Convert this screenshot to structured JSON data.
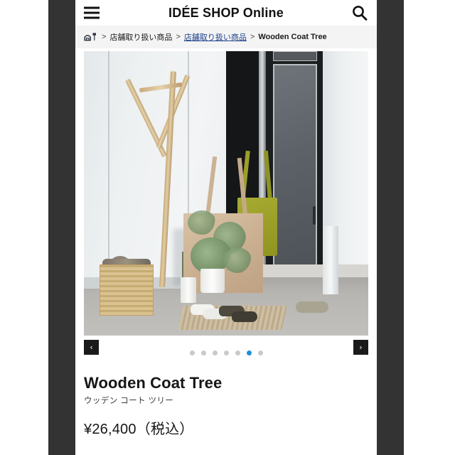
{
  "header": {
    "site_title": "IDÉE SHOP Online",
    "menu_icon": "hamburger-icon",
    "search_icon": "search-icon"
  },
  "breadcrumb": {
    "home_icon": "home-shop-icon",
    "separator": ">",
    "items": [
      {
        "label": "店舗取り扱い商品",
        "link": false
      },
      {
        "label": "店舗取り扱い商品",
        "link": true
      },
      {
        "label": "Wooden Coat Tree",
        "current": true
      }
    ]
  },
  "gallery": {
    "prev_label": "‹",
    "next_label": "›",
    "total_slides": 7,
    "active_slide": 6,
    "image_alt": "Wooden coat tree in an entryway with tote bags, basket, plants and slippers",
    "active_dot_color": "#1e8fd5",
    "inactive_dot_color": "#c9c9c9"
  },
  "product": {
    "title": "Wooden Coat Tree",
    "subtitle": "ウッデン コート ツリー",
    "price": "¥26,400（税込）"
  }
}
